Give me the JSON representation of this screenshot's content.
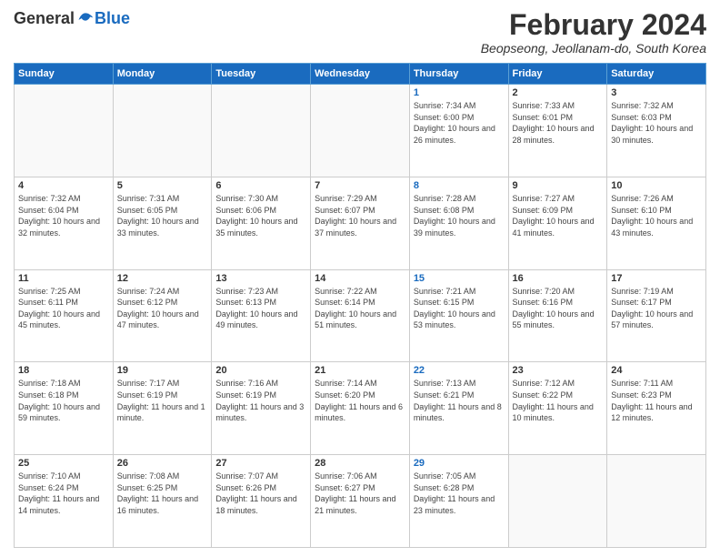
{
  "logo": {
    "general": "General",
    "blue": "Blue"
  },
  "title": "February 2024",
  "subtitle": "Beopseong, Jeollanam-do, South Korea",
  "days_of_week": [
    "Sunday",
    "Monday",
    "Tuesday",
    "Wednesday",
    "Thursday",
    "Friday",
    "Saturday"
  ],
  "weeks": [
    [
      {
        "day": "",
        "info": ""
      },
      {
        "day": "",
        "info": ""
      },
      {
        "day": "",
        "info": ""
      },
      {
        "day": "",
        "info": ""
      },
      {
        "day": "1",
        "info": "Sunrise: 7:34 AM\nSunset: 6:00 PM\nDaylight: 10 hours\nand 26 minutes."
      },
      {
        "day": "2",
        "info": "Sunrise: 7:33 AM\nSunset: 6:01 PM\nDaylight: 10 hours\nand 28 minutes."
      },
      {
        "day": "3",
        "info": "Sunrise: 7:32 AM\nSunset: 6:03 PM\nDaylight: 10 hours\nand 30 minutes."
      }
    ],
    [
      {
        "day": "4",
        "info": "Sunrise: 7:32 AM\nSunset: 6:04 PM\nDaylight: 10 hours\nand 32 minutes."
      },
      {
        "day": "5",
        "info": "Sunrise: 7:31 AM\nSunset: 6:05 PM\nDaylight: 10 hours\nand 33 minutes."
      },
      {
        "day": "6",
        "info": "Sunrise: 7:30 AM\nSunset: 6:06 PM\nDaylight: 10 hours\nand 35 minutes."
      },
      {
        "day": "7",
        "info": "Sunrise: 7:29 AM\nSunset: 6:07 PM\nDaylight: 10 hours\nand 37 minutes."
      },
      {
        "day": "8",
        "info": "Sunrise: 7:28 AM\nSunset: 6:08 PM\nDaylight: 10 hours\nand 39 minutes."
      },
      {
        "day": "9",
        "info": "Sunrise: 7:27 AM\nSunset: 6:09 PM\nDaylight: 10 hours\nand 41 minutes."
      },
      {
        "day": "10",
        "info": "Sunrise: 7:26 AM\nSunset: 6:10 PM\nDaylight: 10 hours\nand 43 minutes."
      }
    ],
    [
      {
        "day": "11",
        "info": "Sunrise: 7:25 AM\nSunset: 6:11 PM\nDaylight: 10 hours\nand 45 minutes."
      },
      {
        "day": "12",
        "info": "Sunrise: 7:24 AM\nSunset: 6:12 PM\nDaylight: 10 hours\nand 47 minutes."
      },
      {
        "day": "13",
        "info": "Sunrise: 7:23 AM\nSunset: 6:13 PM\nDaylight: 10 hours\nand 49 minutes."
      },
      {
        "day": "14",
        "info": "Sunrise: 7:22 AM\nSunset: 6:14 PM\nDaylight: 10 hours\nand 51 minutes."
      },
      {
        "day": "15",
        "info": "Sunrise: 7:21 AM\nSunset: 6:15 PM\nDaylight: 10 hours\nand 53 minutes."
      },
      {
        "day": "16",
        "info": "Sunrise: 7:20 AM\nSunset: 6:16 PM\nDaylight: 10 hours\nand 55 minutes."
      },
      {
        "day": "17",
        "info": "Sunrise: 7:19 AM\nSunset: 6:17 PM\nDaylight: 10 hours\nand 57 minutes."
      }
    ],
    [
      {
        "day": "18",
        "info": "Sunrise: 7:18 AM\nSunset: 6:18 PM\nDaylight: 10 hours\nand 59 minutes."
      },
      {
        "day": "19",
        "info": "Sunrise: 7:17 AM\nSunset: 6:19 PM\nDaylight: 11 hours\nand 1 minute."
      },
      {
        "day": "20",
        "info": "Sunrise: 7:16 AM\nSunset: 6:19 PM\nDaylight: 11 hours\nand 3 minutes."
      },
      {
        "day": "21",
        "info": "Sunrise: 7:14 AM\nSunset: 6:20 PM\nDaylight: 11 hours\nand 6 minutes."
      },
      {
        "day": "22",
        "info": "Sunrise: 7:13 AM\nSunset: 6:21 PM\nDaylight: 11 hours\nand 8 minutes."
      },
      {
        "day": "23",
        "info": "Sunrise: 7:12 AM\nSunset: 6:22 PM\nDaylight: 11 hours\nand 10 minutes."
      },
      {
        "day": "24",
        "info": "Sunrise: 7:11 AM\nSunset: 6:23 PM\nDaylight: 11 hours\nand 12 minutes."
      }
    ],
    [
      {
        "day": "25",
        "info": "Sunrise: 7:10 AM\nSunset: 6:24 PM\nDaylight: 11 hours\nand 14 minutes."
      },
      {
        "day": "26",
        "info": "Sunrise: 7:08 AM\nSunset: 6:25 PM\nDaylight: 11 hours\nand 16 minutes."
      },
      {
        "day": "27",
        "info": "Sunrise: 7:07 AM\nSunset: 6:26 PM\nDaylight: 11 hours\nand 18 minutes."
      },
      {
        "day": "28",
        "info": "Sunrise: 7:06 AM\nSunset: 6:27 PM\nDaylight: 11 hours\nand 21 minutes."
      },
      {
        "day": "29",
        "info": "Sunrise: 7:05 AM\nSunset: 6:28 PM\nDaylight: 11 hours\nand 23 minutes."
      },
      {
        "day": "",
        "info": ""
      },
      {
        "day": "",
        "info": ""
      }
    ]
  ]
}
